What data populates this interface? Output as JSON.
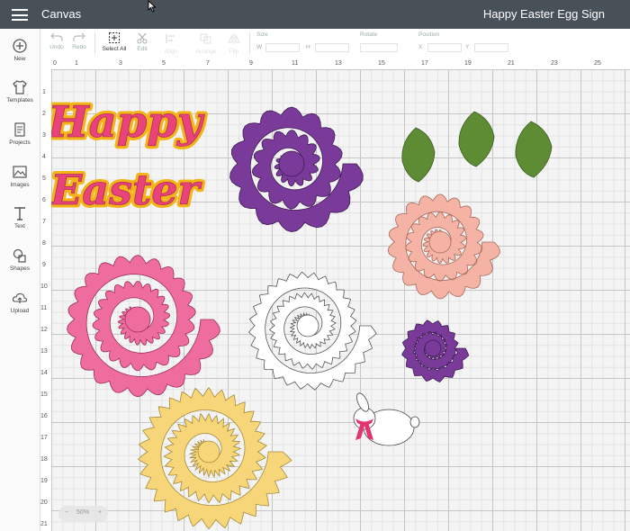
{
  "header": {
    "app_title": "Canvas",
    "project_title": "Happy Easter Egg Sign",
    "menu_icon": "hamburger-menu-icon"
  },
  "sidebar": {
    "items": [
      {
        "label": "New",
        "icon": "plus-circle-icon"
      },
      {
        "label": "Templates",
        "icon": "tshirt-icon"
      },
      {
        "label": "Projects",
        "icon": "projects-icon"
      },
      {
        "label": "Images",
        "icon": "image-icon"
      },
      {
        "label": "Text",
        "icon": "text-t-icon"
      },
      {
        "label": "Shapes",
        "icon": "shapes-icon"
      },
      {
        "label": "Upload",
        "icon": "upload-cloud-icon"
      }
    ]
  },
  "toolbar": {
    "undo": "Undo",
    "redo": "Redo",
    "select_all": "Select All",
    "edit": "Edit",
    "align": "Align",
    "arrange": "Arrange",
    "flip": "Flip",
    "size": "Size",
    "w": "W",
    "h": "H",
    "rotate": "Rotate",
    "position": "Position",
    "x": "X",
    "y": "Y"
  },
  "ruler": {
    "top": [
      "0",
      "1",
      "3",
      "5",
      "7",
      "9",
      "11",
      "13",
      "15",
      "17",
      "19",
      "21",
      "23",
      "25"
    ],
    "left": [
      "1",
      "2",
      "3",
      "4",
      "5",
      "6",
      "7",
      "8",
      "9",
      "10",
      "11",
      "12",
      "13",
      "14",
      "15",
      "16",
      "17",
      "18",
      "19",
      "20",
      "21"
    ]
  },
  "canvas_objects": {
    "happy_text": "Happy",
    "easter_text": "Easter",
    "colors": {
      "pink_text": "#e8437a",
      "gold_backing": "#f2b416",
      "purple": "#7a3a9a",
      "green": "#5e8c34",
      "peach": "#f4b3a4",
      "rose": "#ee6d9e",
      "yellow": "#f7d67a",
      "ribbon": "#e2356e"
    }
  },
  "zoom": {
    "level": "50%",
    "minus": "−",
    "plus": "+"
  }
}
